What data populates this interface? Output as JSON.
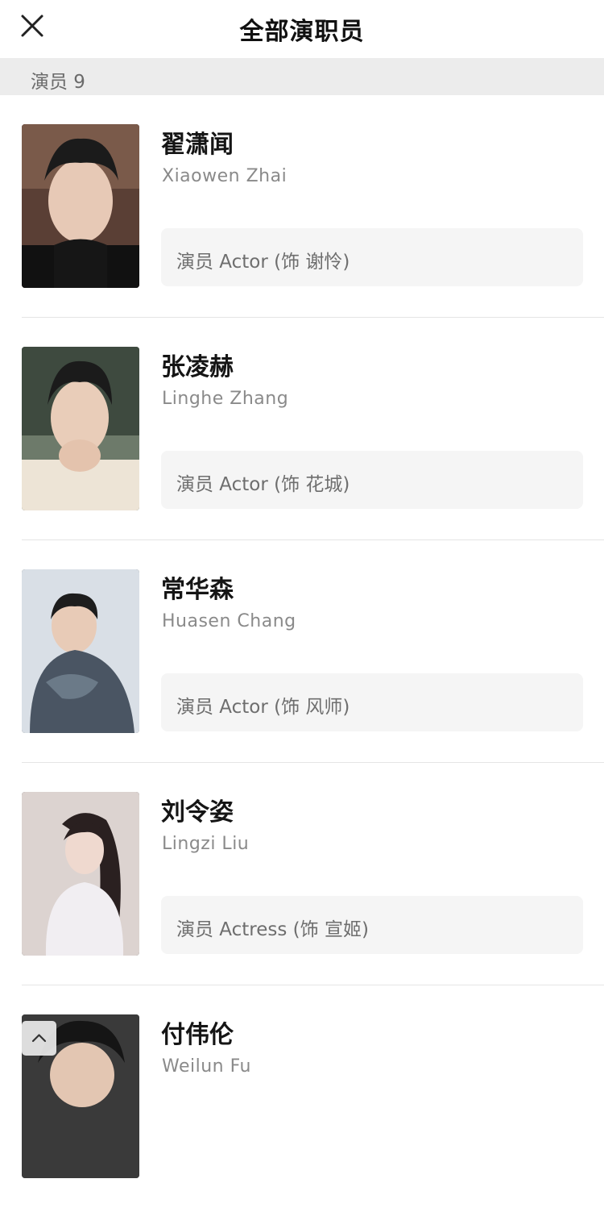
{
  "header": {
    "title": "全部演职员",
    "close_icon": "close-icon"
  },
  "section": {
    "label": "演员 9"
  },
  "cast": [
    {
      "name": "翟潇闻",
      "english_name": "Xiaowen Zhai",
      "role": "演员 Actor (饰 谢怜)"
    },
    {
      "name": "张凌赫",
      "english_name": "Linghe Zhang",
      "role": "演员 Actor (饰 花城)"
    },
    {
      "name": "常华森",
      "english_name": "Huasen Chang",
      "role": "演员 Actor (饰 风师)"
    },
    {
      "name": "刘令姿",
      "english_name": "Lingzi Liu",
      "role": "演员 Actress (饰 宣姬)"
    },
    {
      "name": "付伟伦",
      "english_name": "Weilun Fu",
      "role": ""
    }
  ],
  "scroll_top": {
    "icon": "chevron-up-icon"
  },
  "colors": {
    "section_bg": "#ececec",
    "role_bg": "#f5f5f5",
    "secondary_text": "#8a8a8a",
    "divider": "#e5e5e5"
  }
}
